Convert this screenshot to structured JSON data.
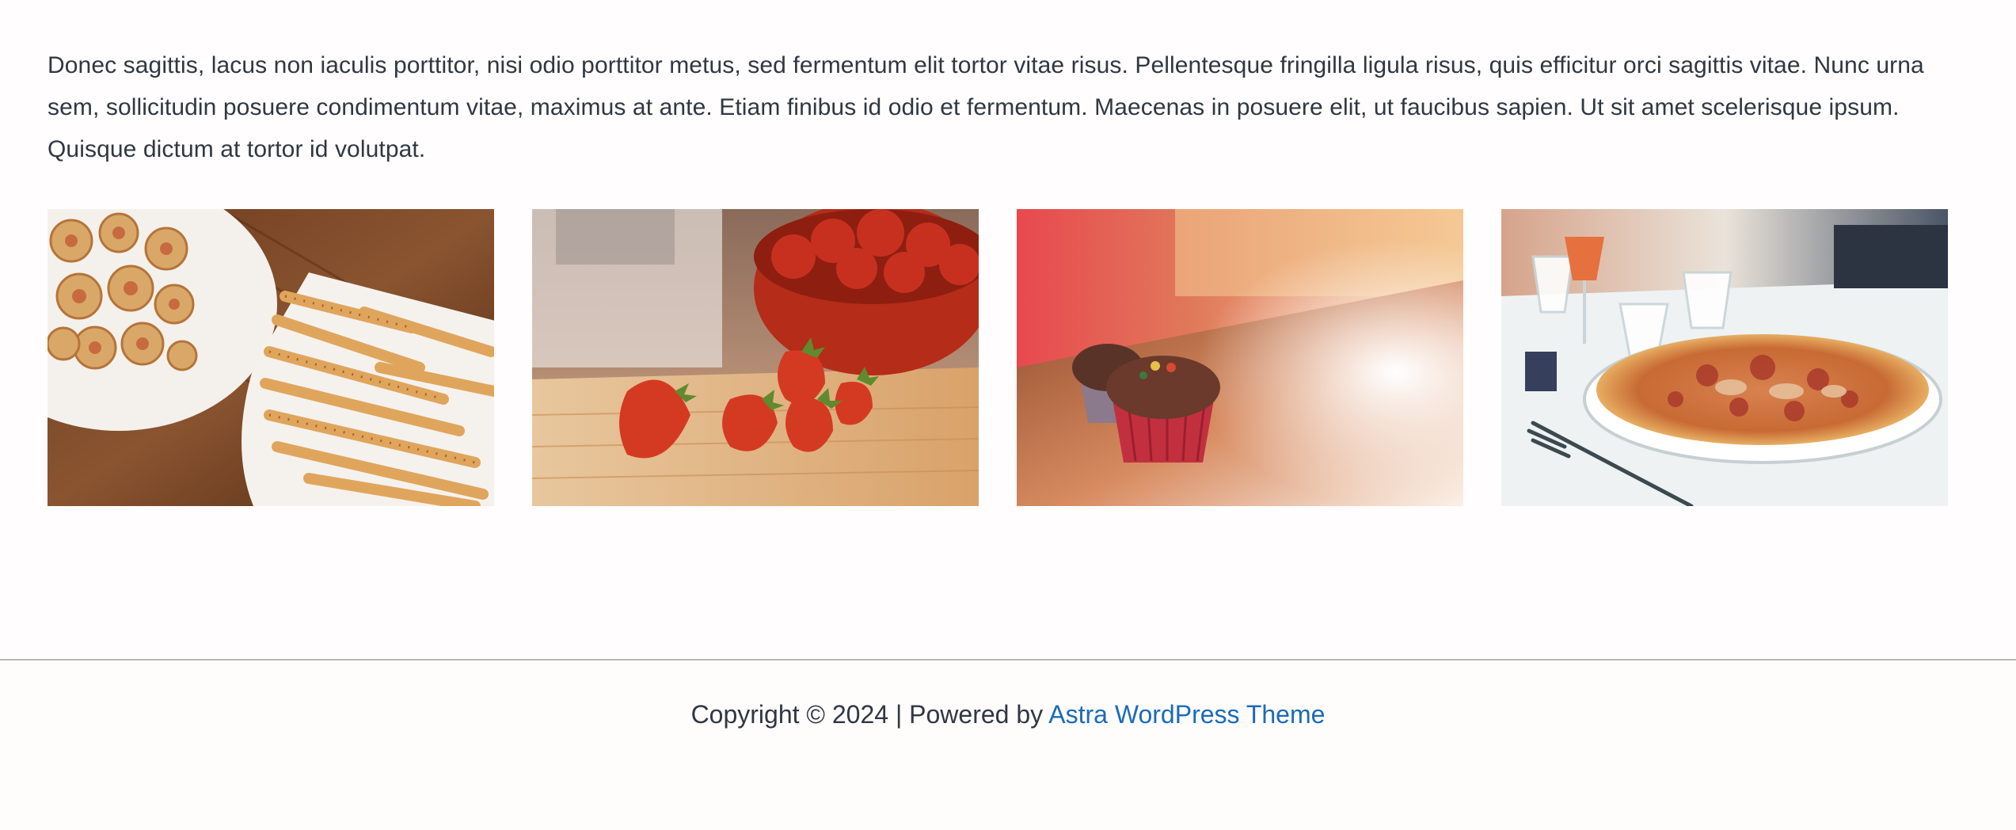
{
  "intro": {
    "text": "Donec sagittis, lacus non iaculis porttitor, nisi odio porttitor metus, sed fermentum elit tortor vitae risus. Pellentesque fringilla ligula risus, quis efficitur orci sagittis vitae. Nunc urna sem, sollicitudin posuere condimentum vitae, maximus at ante. Etiam finibus id odio et fermentum. Maecenas in posuere elit, ut faucibus sapien. Ut sit amet scelerisque ipsum. Quisque dictum at tortor id volutpat."
  },
  "gallery": {
    "items": [
      {
        "subject": "pastries-on-plates"
      },
      {
        "subject": "strawberries-on-cutting-board"
      },
      {
        "subject": "cupcakes-on-table"
      },
      {
        "subject": "pizza-on-table"
      }
    ]
  },
  "footer": {
    "copyright_prefix": "Copyright © 2024 | Powered by ",
    "theme_link": "Astra WordPress Theme",
    "link_color": "#1a6bb8",
    "text_color": "#2f3742"
  }
}
